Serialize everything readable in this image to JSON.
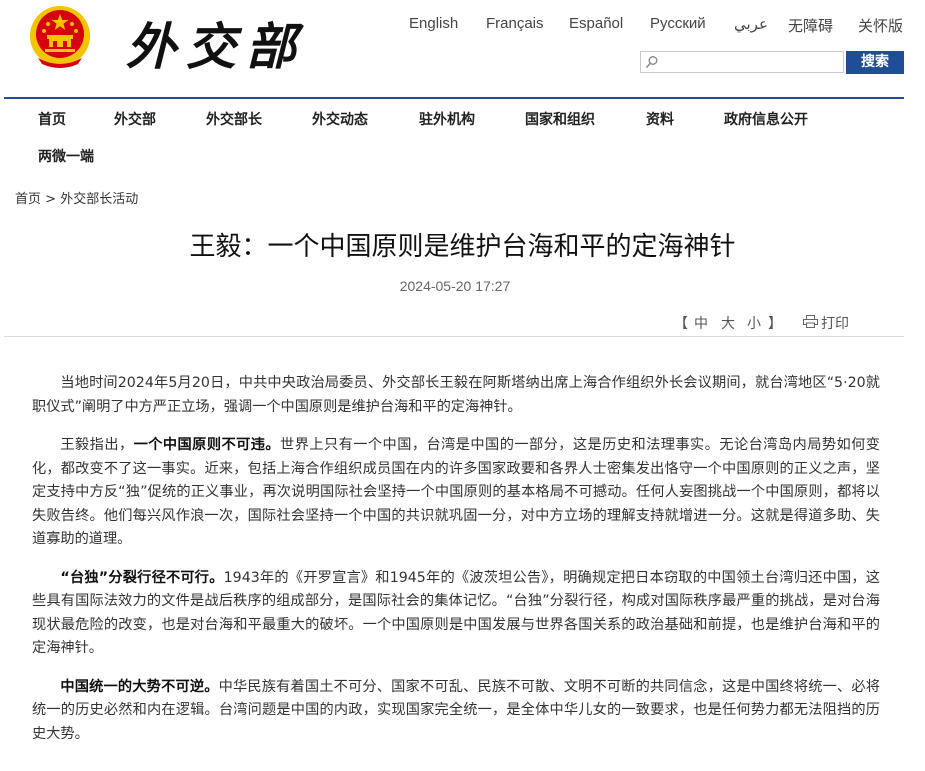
{
  "header": {
    "site_logo_text": "外交部",
    "languages": [
      "English",
      "Français",
      "Español",
      "Русский",
      "عربي",
      "无障碍",
      "关怀版"
    ],
    "search": {
      "placeholder": "",
      "button_label": "搜索"
    }
  },
  "nav": {
    "items": [
      "首页",
      "外交部",
      "外交部长",
      "外交动态",
      "驻外机构",
      "国家和组织",
      "资料",
      "政府信息公开",
      "两微一端"
    ]
  },
  "breadcrumb": {
    "home": "首页",
    "separator": ">",
    "current": "外交部长活动"
  },
  "article": {
    "title": "王毅：一个中国原则是维护台海和平的定海神针",
    "date": "2024-05-20 17:27",
    "font_size_controls": {
      "open": "【",
      "large": "中",
      "medium": "大",
      "small": "小",
      "close": "】"
    },
    "print_label": "打印",
    "paragraphs": [
      {
        "lead": "",
        "text": "当地时间2024年5月20日，中共中央政治局委员、外交部长王毅在阿斯塔纳出席上海合作组织外长会议期间，就台湾地区“5·20就职仪式”阐明了中方严正立场，强调一个中国原则是维护台海和平的定海神针。"
      },
      {
        "prefix": "王毅指出，",
        "lead": "一个中国原则不可违。",
        "text": "世界上只有一个中国，台湾是中国的一部分，这是历史和法理事实。无论台湾岛内局势如何变化，都改变不了这一事实。近来，包括上海合作组织成员国在内的许多国家政要和各界人士密集发出恪守一个中国原则的正义之声，坚定支持中方反“独”促统的正义事业，再次说明国际社会坚持一个中国原则的基本格局不可撼动。任何人妄图挑战一个中国原则，都将以失败告终。他们每兴风作浪一次，国际社会坚持一个中国的共识就巩固一分，对中方立场的理解支持就增进一分。这就是得道多助、失道寡助的道理。"
      },
      {
        "prefix": "",
        "lead": "“台独”分裂行径不可行。",
        "text": "1943年的《开罗宣言》和1945年的《波茨坦公告》，明确规定把日本窃取的中国领土台湾归还中国，这些具有国际法效力的文件是战后秩序的组成部分，是国际社会的集体记忆。“台独”分裂行径，构成对国际秩序最严重的挑战，是对台海现状最危险的改变，也是对台海和平最重大的破坏。一个中国原则是中国发展与世界各国关系的政治基础和前提，也是维护台海和平的定海神针。"
      },
      {
        "prefix": "",
        "lead": "中国统一的大势不可逆。",
        "text": "中华民族有着国土不可分、国家不可乱、民族不可散、文明不可断的共同信念，这是中国终将统一、必将统一的历史必然和内在逻辑。台湾问题是中国的内政，实现国家完全统一，是全体中华儿女的一致要求，也是任何势力都无法阻挡的历史大势。"
      }
    ]
  },
  "colors": {
    "accent": "#1f4e96",
    "emblem_red": "#d7000f",
    "emblem_gold": "#f4c400"
  }
}
